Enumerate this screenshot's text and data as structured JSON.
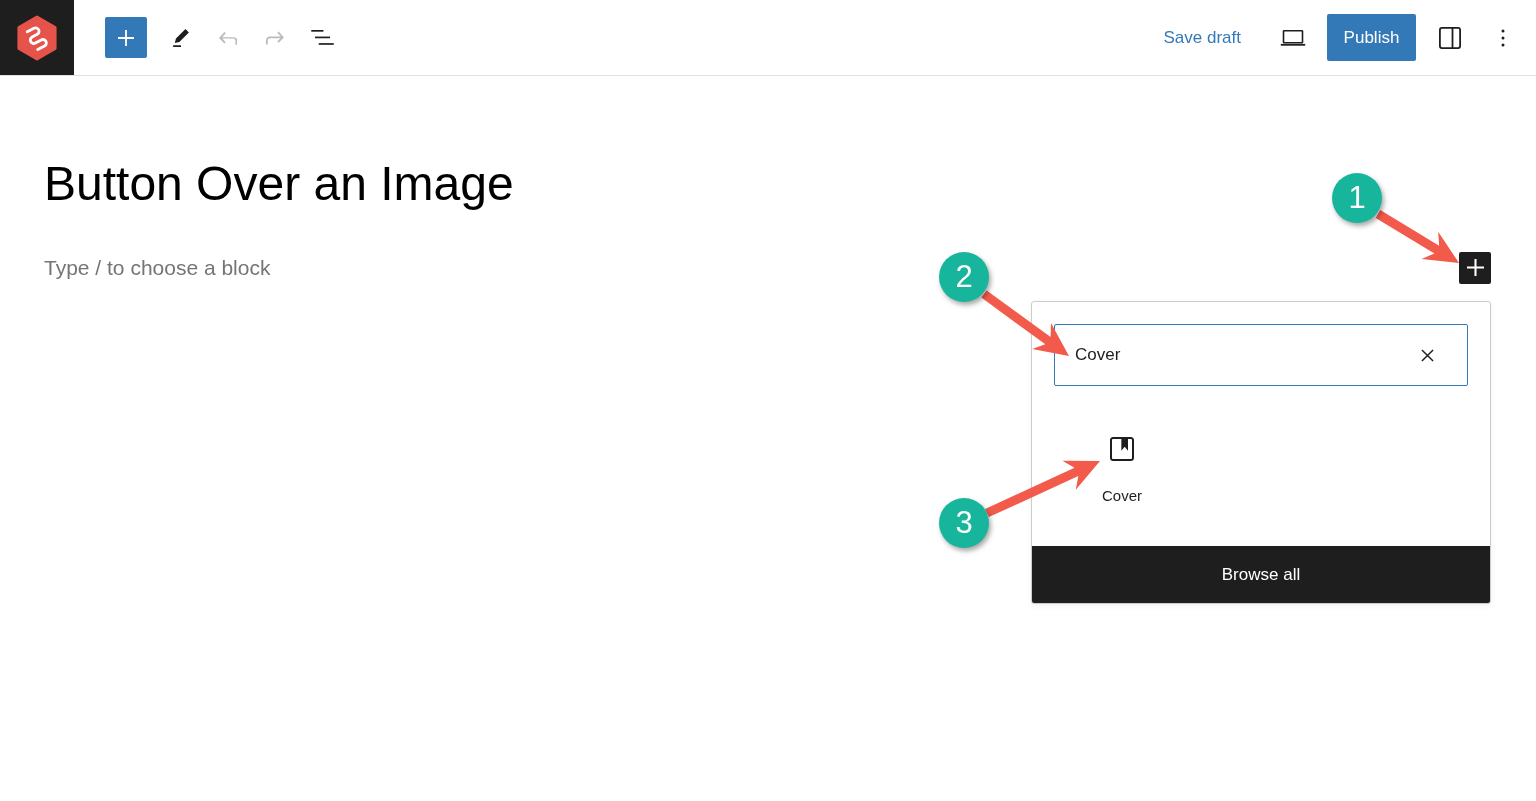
{
  "header": {
    "tools": [
      {
        "kind": "add",
        "disabled": false
      },
      {
        "kind": "edit",
        "disabled": false
      },
      {
        "kind": "undo",
        "disabled": true
      },
      {
        "kind": "redo",
        "disabled": true
      },
      {
        "kind": "list",
        "disabled": false
      }
    ],
    "save_draft": "Save draft",
    "publish": "Publish"
  },
  "document": {
    "title": "Button Over an Image",
    "paragraph": {
      "placeholder": "Type / to choose a block"
    }
  },
  "inserter": {
    "search": {
      "value": "Cover"
    },
    "results": [
      {
        "label": "Cover"
      }
    ],
    "footer": "Browse all"
  },
  "annotations": [
    {
      "number": "1"
    },
    {
      "number": "2"
    },
    {
      "number": "3"
    }
  ]
}
